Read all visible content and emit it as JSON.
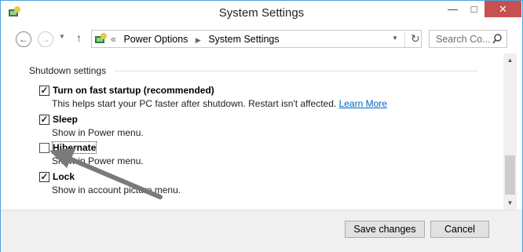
{
  "window": {
    "title": "System Settings"
  },
  "navigation": {
    "breadcrumb": {
      "lead": "«",
      "items": [
        "Power Options",
        "System Settings"
      ]
    },
    "search_placeholder": "Search Co..."
  },
  "shutdown": {
    "section_title": "Shutdown settings",
    "options": [
      {
        "label": "Turn on fast startup (recommended)",
        "desc": "This helps start your PC faster after shutdown. Restart isn't affected.",
        "link": "Learn More",
        "checked": true
      },
      {
        "label": "Sleep",
        "desc": "Show in Power menu.",
        "checked": true
      },
      {
        "label": "Hibernate",
        "desc": "Show in Power menu.",
        "checked": false
      },
      {
        "label": "Lock",
        "desc": "Show in account picture menu.",
        "checked": true
      }
    ]
  },
  "footer": {
    "save_label": "Save changes",
    "cancel_label": "Cancel"
  },
  "colors": {
    "accent": "#4aa3df",
    "link": "#0066cc",
    "close": "#c75050"
  }
}
